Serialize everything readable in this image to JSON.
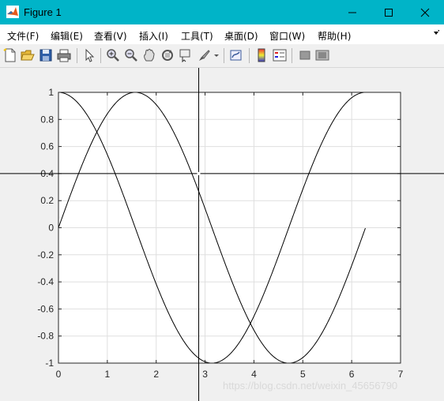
{
  "window": {
    "title": "Figure 1",
    "minimize_icon": "minimize-icon",
    "maximize_icon": "maximize-icon",
    "close_icon": "close-icon"
  },
  "menu": {
    "items": [
      "文件(F)",
      "编辑(E)",
      "查看(V)",
      "插入(I)",
      "工具(T)",
      "桌面(D)",
      "窗口(W)",
      "帮助(H)"
    ]
  },
  "toolbar": {
    "icons": [
      "new-figure-icon",
      "open-file-icon",
      "save-icon",
      "print-icon",
      "pointer-icon",
      "zoom-in-icon",
      "zoom-out-icon",
      "pan-icon",
      "rotate-3d-icon",
      "data-cursor-icon",
      "brush-icon",
      "link-plot-icon",
      "colorbar-icon",
      "legend-icon",
      "hide-plot-tools-icon",
      "show-plot-tools-icon"
    ]
  },
  "chart_data": {
    "type": "line",
    "title": "",
    "xlabel": "",
    "ylabel": "",
    "xlim": [
      0,
      7
    ],
    "ylim": [
      -1,
      1
    ],
    "grid": true,
    "xticks": [
      "0",
      "1",
      "2",
      "3",
      "4",
      "5",
      "6",
      "7"
    ],
    "yticks": [
      "1",
      "0.8",
      "0.6",
      "0.4",
      "0.2",
      "0",
      "-0.2",
      "-0.4",
      "-0.6",
      "-0.8",
      "-1"
    ],
    "series": [
      {
        "function": "sin(x)",
        "x_range": [
          0,
          6.28
        ],
        "color": "#000000"
      },
      {
        "function": "cos(x)",
        "x_range": [
          0,
          6.28
        ],
        "color": "#000000"
      }
    ],
    "crosshair": {
      "x": 2.87,
      "y": 0.4
    }
  },
  "watermark": "https://blog.csdn.net/weixin_45656790",
  "colors": {
    "titlebar": "#00b4c8",
    "background": "#f0f0f0",
    "axes": "#ffffff"
  }
}
